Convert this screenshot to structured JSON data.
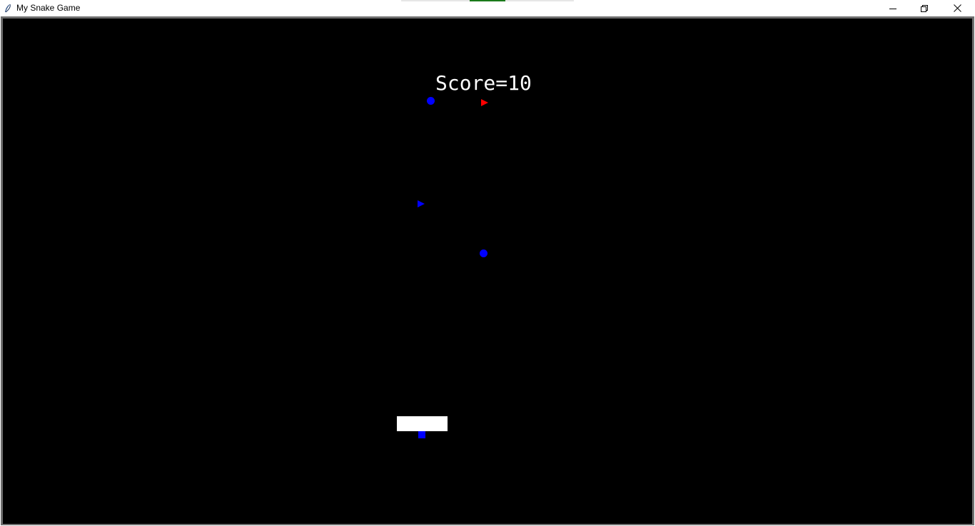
{
  "window": {
    "title": "My Snake Game",
    "icon": "feather-icon",
    "controls": {
      "minimize_icon": "minimize-icon",
      "restore_icon": "restore-icon",
      "close_icon": "close-icon"
    }
  },
  "game": {
    "score_text": "Score=10",
    "colors": {
      "background": "#000000",
      "text": "#ffffff",
      "blue_entity": "#0000ff",
      "red_entity": "#ff0000",
      "paddle": "#ffffff"
    },
    "entities": [
      {
        "kind": "circle",
        "color": "blue"
      },
      {
        "kind": "triangle-right",
        "color": "red"
      },
      {
        "kind": "triangle-right",
        "color": "blue"
      },
      {
        "kind": "circle",
        "color": "blue"
      },
      {
        "kind": "rectangle",
        "color": "white"
      },
      {
        "kind": "square",
        "color": "blue"
      }
    ]
  }
}
